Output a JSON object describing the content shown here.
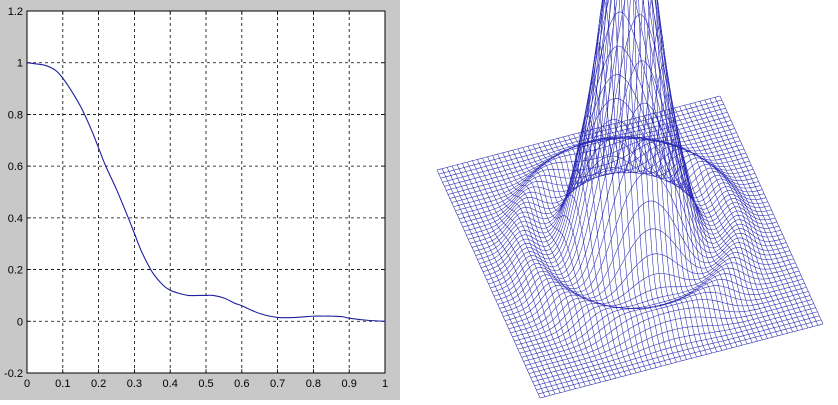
{
  "chart_data": [
    {
      "type": "line",
      "title": "",
      "xlabel": "",
      "ylabel": "",
      "xlim": [
        0,
        1
      ],
      "ylim": [
        -0.2,
        1.2
      ],
      "grid": true,
      "xticks": [
        "0",
        "0.1",
        "0.2",
        "0.3",
        "0.4",
        "0.5",
        "0.6",
        "0.7",
        "0.8",
        "0.9",
        "1"
      ],
      "yticks": [
        "-0.2",
        "0",
        "0.2",
        "0.4",
        "0.6",
        "0.8",
        "1",
        "1.2"
      ],
      "line_color": "#1f1fa0",
      "series": [
        {
          "x": [
            0,
            0.05,
            0.08,
            0.1,
            0.12,
            0.15,
            0.18,
            0.2,
            0.22,
            0.25,
            0.28,
            0.3,
            0.32,
            0.35,
            0.38,
            0.4,
            0.42,
            0.45,
            0.48,
            0.5,
            0.52,
            0.55,
            0.58,
            0.6,
            0.65,
            0.7,
            0.75,
            0.8,
            0.83,
            0.85,
            0.88,
            0.9,
            0.95,
            1.0
          ],
          "y": [
            1.0,
            0.99,
            0.97,
            0.94,
            0.9,
            0.83,
            0.74,
            0.67,
            0.6,
            0.51,
            0.41,
            0.34,
            0.27,
            0.19,
            0.14,
            0.12,
            0.11,
            0.1,
            0.1,
            0.1,
            0.1,
            0.09,
            0.07,
            0.06,
            0.03,
            0.015,
            0.015,
            0.02,
            0.02,
            0.02,
            0.018,
            0.012,
            0.004,
            0.0
          ]
        }
      ]
    },
    {
      "type": "surface",
      "title": "",
      "description": "3D wireframe mesh surface with a single tall central peak and a faint surrounding ring",
      "mesh_color": "#2828b4",
      "peak_value": 1.0
    }
  ]
}
